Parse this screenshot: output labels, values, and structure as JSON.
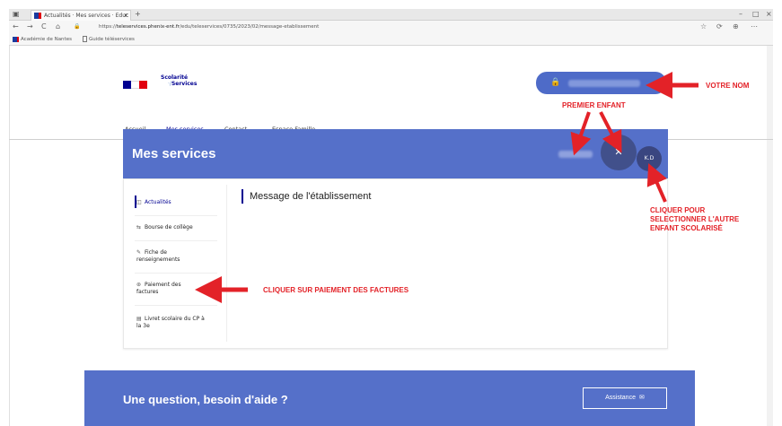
{
  "browser": {
    "tab_title": "Actualités · Mes services · Educ",
    "tab_close": "x",
    "new_tab": "+",
    "win_min": "–",
    "win_max": "□",
    "win_close": "×",
    "nav_back": "←",
    "nav_forward": "→",
    "nav_reload": "C",
    "nav_home": "⌂",
    "lock": "🔒",
    "url_prefix": "https://",
    "url_domain": "teleservices.phenix-ent.fr",
    "url_rest": "/edu/teleservices/0735/2023/02/message-etablissement",
    "tool_icons": [
      "☆",
      "⟳",
      "⊕",
      "⋯"
    ],
    "bookmarks": [
      "Académie de Nantes",
      "Guide téléservices"
    ]
  },
  "site": {
    "logo_line1": "Scolarité",
    "logo_line2": "Services",
    "logo_swoosh": "·/",
    "nav": [
      "Accueil",
      "Mes services",
      "Contact",
      "Espace Famille"
    ],
    "user_lock": "🔒",
    "services_title": "Mes services",
    "child1_icon": "✕",
    "child2_initials": "K.D",
    "menu": [
      {
        "icon": "◫",
        "label": "Actualités"
      },
      {
        "icon": "⇆",
        "label": "Bourse de collège"
      },
      {
        "icon": "✎",
        "label": "Fiche de renseignements"
      },
      {
        "icon": "⊛",
        "label": "Paiement des factures"
      },
      {
        "icon": "▤",
        "label": "Livret scolaire du CP à la 3e"
      }
    ],
    "message_title": "Message de l'établissement",
    "help_title": "Une question, besoin d'aide ?",
    "assist_label": "Assistance",
    "assist_icon": "✉"
  },
  "annotations": {
    "votre_nom": "VOTRE NOM",
    "premier_enfant": "PREMIER ENFANT",
    "cliquer_autre": [
      "CLIQUER POUR",
      "SELECTIONNER L'AUTRE",
      "ENFANT SCOLARISÉ"
    ],
    "cliquer_paiement": "CLIQUER SUR PAIEMENT DES FACTURES",
    "color": "#e32228"
  },
  "colors": {
    "primary_blue": "#000091",
    "band_blue": "#5570c9",
    "pill_blue": "#4e6bc8",
    "marianne_red": "#e1000f"
  }
}
